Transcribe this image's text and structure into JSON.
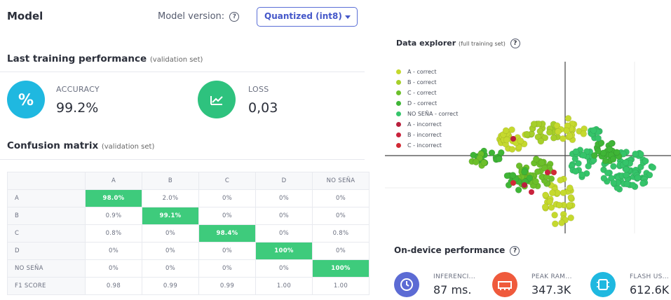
{
  "model": {
    "title": "Model",
    "version_label": "Model version:",
    "version_value": "Quantized (int8)"
  },
  "training": {
    "title": "Last training performance",
    "subtitle": "(validation set)",
    "accuracy_label": "ACCURACY",
    "accuracy_value": "99.2%",
    "accuracy_icon": "percent-icon",
    "accuracy_color": "#1fb8e0",
    "loss_label": "LOSS",
    "loss_value": "0,03",
    "loss_icon": "trend-chart-icon",
    "loss_color": "#2ec27e"
  },
  "confusion": {
    "title": "Confusion matrix",
    "subtitle": "(validation set)",
    "columns": [
      "A",
      "B",
      "C",
      "D",
      "NO SEÑA"
    ],
    "rows": [
      {
        "label": "A",
        "cells": [
          "98.0%",
          "2.0%",
          "0%",
          "0%",
          "0%"
        ]
      },
      {
        "label": "B",
        "cells": [
          "0.9%",
          "99.1%",
          "0%",
          "0%",
          "0%"
        ]
      },
      {
        "label": "C",
        "cells": [
          "0.8%",
          "0%",
          "98.4%",
          "0%",
          "0.8%"
        ]
      },
      {
        "label": "D",
        "cells": [
          "0%",
          "0%",
          "0%",
          "100%",
          "0%"
        ]
      },
      {
        "label": "NO SEÑA",
        "cells": [
          "0%",
          "0%",
          "0%",
          "0%",
          "100%"
        ]
      }
    ],
    "f1_label": "F1 SCORE",
    "f1": [
      "0.98",
      "0.99",
      "0.99",
      "1.00",
      "1.00"
    ],
    "highlight_color": "#3ecb7c"
  },
  "explorer": {
    "title": "Data explorer",
    "subtitle": "(full training set)",
    "legend": [
      {
        "label": "A - correct",
        "color": "#c5d92e"
      },
      {
        "label": "B - correct",
        "color": "#a6cf2a"
      },
      {
        "label": "C - correct",
        "color": "#6cbf2a"
      },
      {
        "label": "D - correct",
        "color": "#3fb536"
      },
      {
        "label": "NO SEÑA - correct",
        "color": "#35c46a"
      },
      {
        "label": "A - incorrect",
        "color": "#b8203d"
      },
      {
        "label": "B - incorrect",
        "color": "#c9233d"
      },
      {
        "label": "C - incorrect",
        "color": "#d12a35"
      }
    ]
  },
  "on_device": {
    "title": "On-device performance",
    "items": [
      {
        "label": "INFERENCI...",
        "value": "87 ms.",
        "icon": "clock-icon",
        "color": "#5c6bd4"
      },
      {
        "label": "PEAK RAM...",
        "value": "347.3K",
        "icon": "memory-icon",
        "color": "#ef5a3c"
      },
      {
        "label": "FLASH US...",
        "value": "612.6K",
        "icon": "chip-icon",
        "color": "#1fb8e0"
      }
    ]
  }
}
